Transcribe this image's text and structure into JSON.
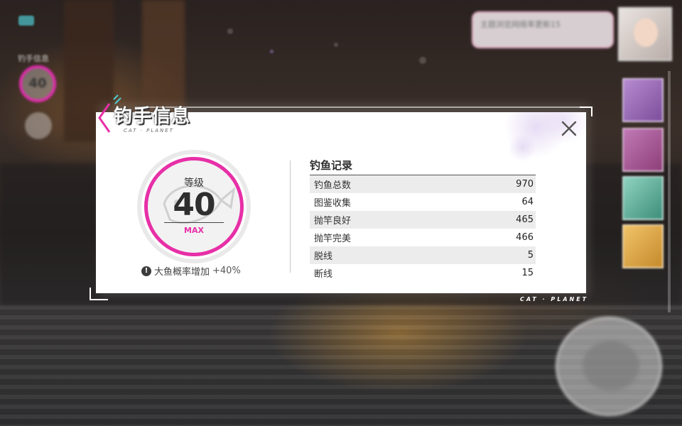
{
  "dialog": {
    "title": "钓手信息",
    "brand": "CAT · PLANET",
    "close_icon": "close-icon",
    "level": {
      "label": "等级",
      "value": "40",
      "max_label": "MAX"
    },
    "bonus": {
      "icon": "!",
      "text": "大鱼概率增加",
      "value": "+40%"
    },
    "records": {
      "title": "钓鱼记录",
      "rows": [
        {
          "label": "钓鱼总数",
          "value": "970"
        },
        {
          "label": "图鉴收集",
          "value": "64"
        },
        {
          "label": "抛竿良好",
          "value": "465"
        },
        {
          "label": "抛竿完美",
          "value": "466"
        },
        {
          "label": "脱线",
          "value": "5"
        },
        {
          "label": "断线",
          "value": "15"
        }
      ]
    }
  },
  "hud": {
    "left_title": "钓手信息",
    "left_level": "40",
    "bottom_brand": "CAT · PLANET",
    "chat_text": "主题浏览网络率更新15"
  },
  "colors": {
    "accent": "#e72fa7",
    "panel": "#ffffff",
    "row_alt": "#ececec"
  }
}
